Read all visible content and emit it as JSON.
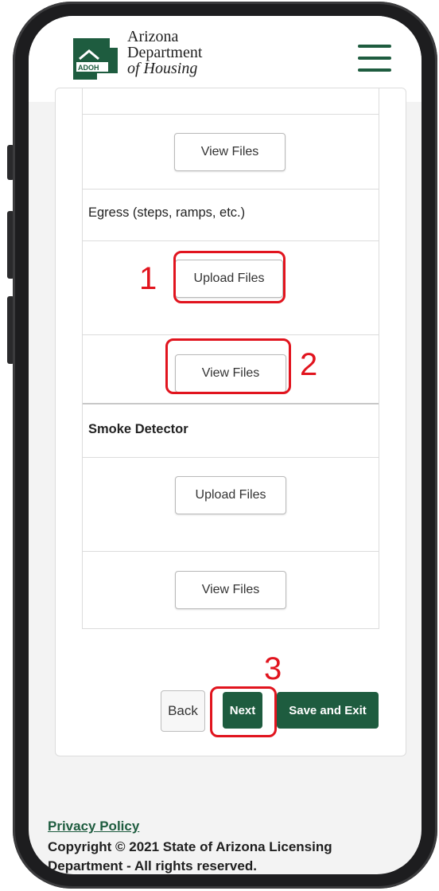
{
  "header": {
    "logo_text": "ADOH",
    "org_line1": "Arizona",
    "org_line2": "Department",
    "org_line3": "of Housing"
  },
  "sections": [
    {
      "label": "",
      "view_label": "View Files"
    },
    {
      "label": "Egress (steps, ramps, etc.)",
      "upload_label": "Upload Files",
      "view_label": "View Files"
    },
    {
      "label": "Smoke Detector",
      "upload_label": "Upload Files",
      "view_label": "View Files"
    }
  ],
  "actions": {
    "back_label": "Back",
    "next_label": "Next",
    "save_exit_label": "Save and Exit"
  },
  "footer": {
    "privacy_label": "Privacy Policy",
    "copyright": "Copyright © 2021 State of Arizona Licensing Department - All rights reserved."
  },
  "annotations": {
    "colors": {
      "highlight": "#e1141e",
      "brand": "#1e5c3f"
    },
    "marker1": "1",
    "marker2": "2",
    "marker3": "3"
  }
}
